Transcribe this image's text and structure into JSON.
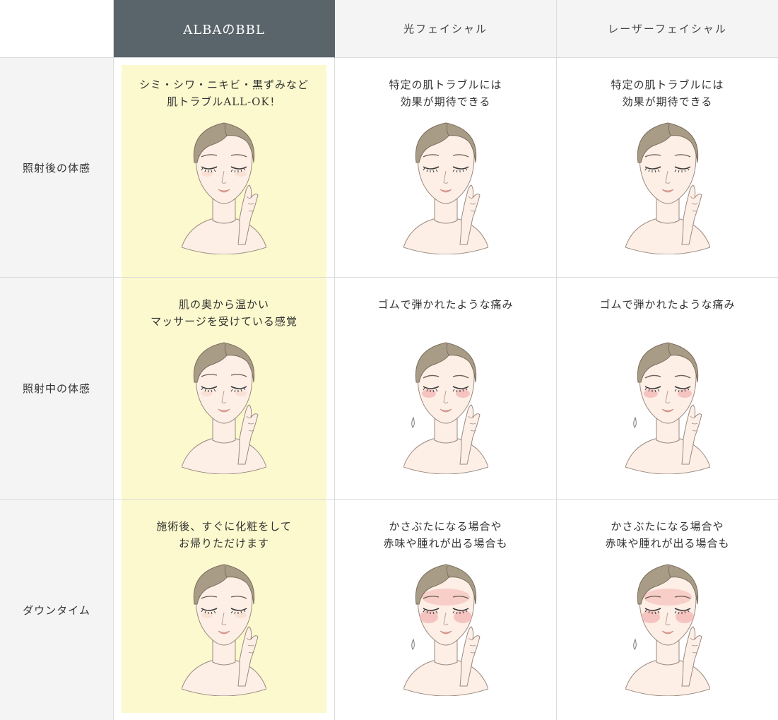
{
  "columns": [
    {
      "label": "ALBAのBBL",
      "featured": true
    },
    {
      "label": "光フェイシャル",
      "featured": false
    },
    {
      "label": "レーザーフェイシャル",
      "featured": false
    }
  ],
  "rows": [
    {
      "label": "照射後の体感",
      "cells": [
        {
          "lines": [
            "シミ・シワ・ニキビ・黒ずみなど",
            "肌トラブルALL-OK！"
          ],
          "face": "calm-smile"
        },
        {
          "lines": [
            "特定の肌トラブルには",
            "効果が期待できる"
          ],
          "face": "calm"
        },
        {
          "lines": [
            "特定の肌トラブルには",
            "効果が期待できる"
          ],
          "face": "calm"
        }
      ]
    },
    {
      "label": "照射中の体感",
      "cells": [
        {
          "lines": [
            "肌の奥から温かい",
            "マッサージを受けている感覚"
          ],
          "face": "calm-smile"
        },
        {
          "lines": [
            "ゴムで弾かれたような痛み"
          ],
          "face": "pained"
        },
        {
          "lines": [
            "ゴムで弾かれたような痛み"
          ],
          "face": "pained"
        }
      ]
    },
    {
      "label": "ダウンタイム",
      "cells": [
        {
          "lines": [
            "施術後、すぐに化粧をして",
            "お帰りただけます"
          ],
          "face": "calm-smile"
        },
        {
          "lines": [
            "かさぶたになる場合や",
            "赤味や腫れが出る場合も"
          ],
          "face": "redness"
        },
        {
          "lines": [
            "かさぶたになる場合や",
            "赤味や腫れが出る場合も"
          ],
          "face": "redness"
        }
      ]
    }
  ],
  "colors": {
    "featured_header_bg": "#59656a",
    "featured_column_bg": "#fbf9cd",
    "header_bg": "#f4f4f4",
    "hair": "#a99c87",
    "skin": "#fdefe6",
    "blush": "#f2a7a7"
  }
}
